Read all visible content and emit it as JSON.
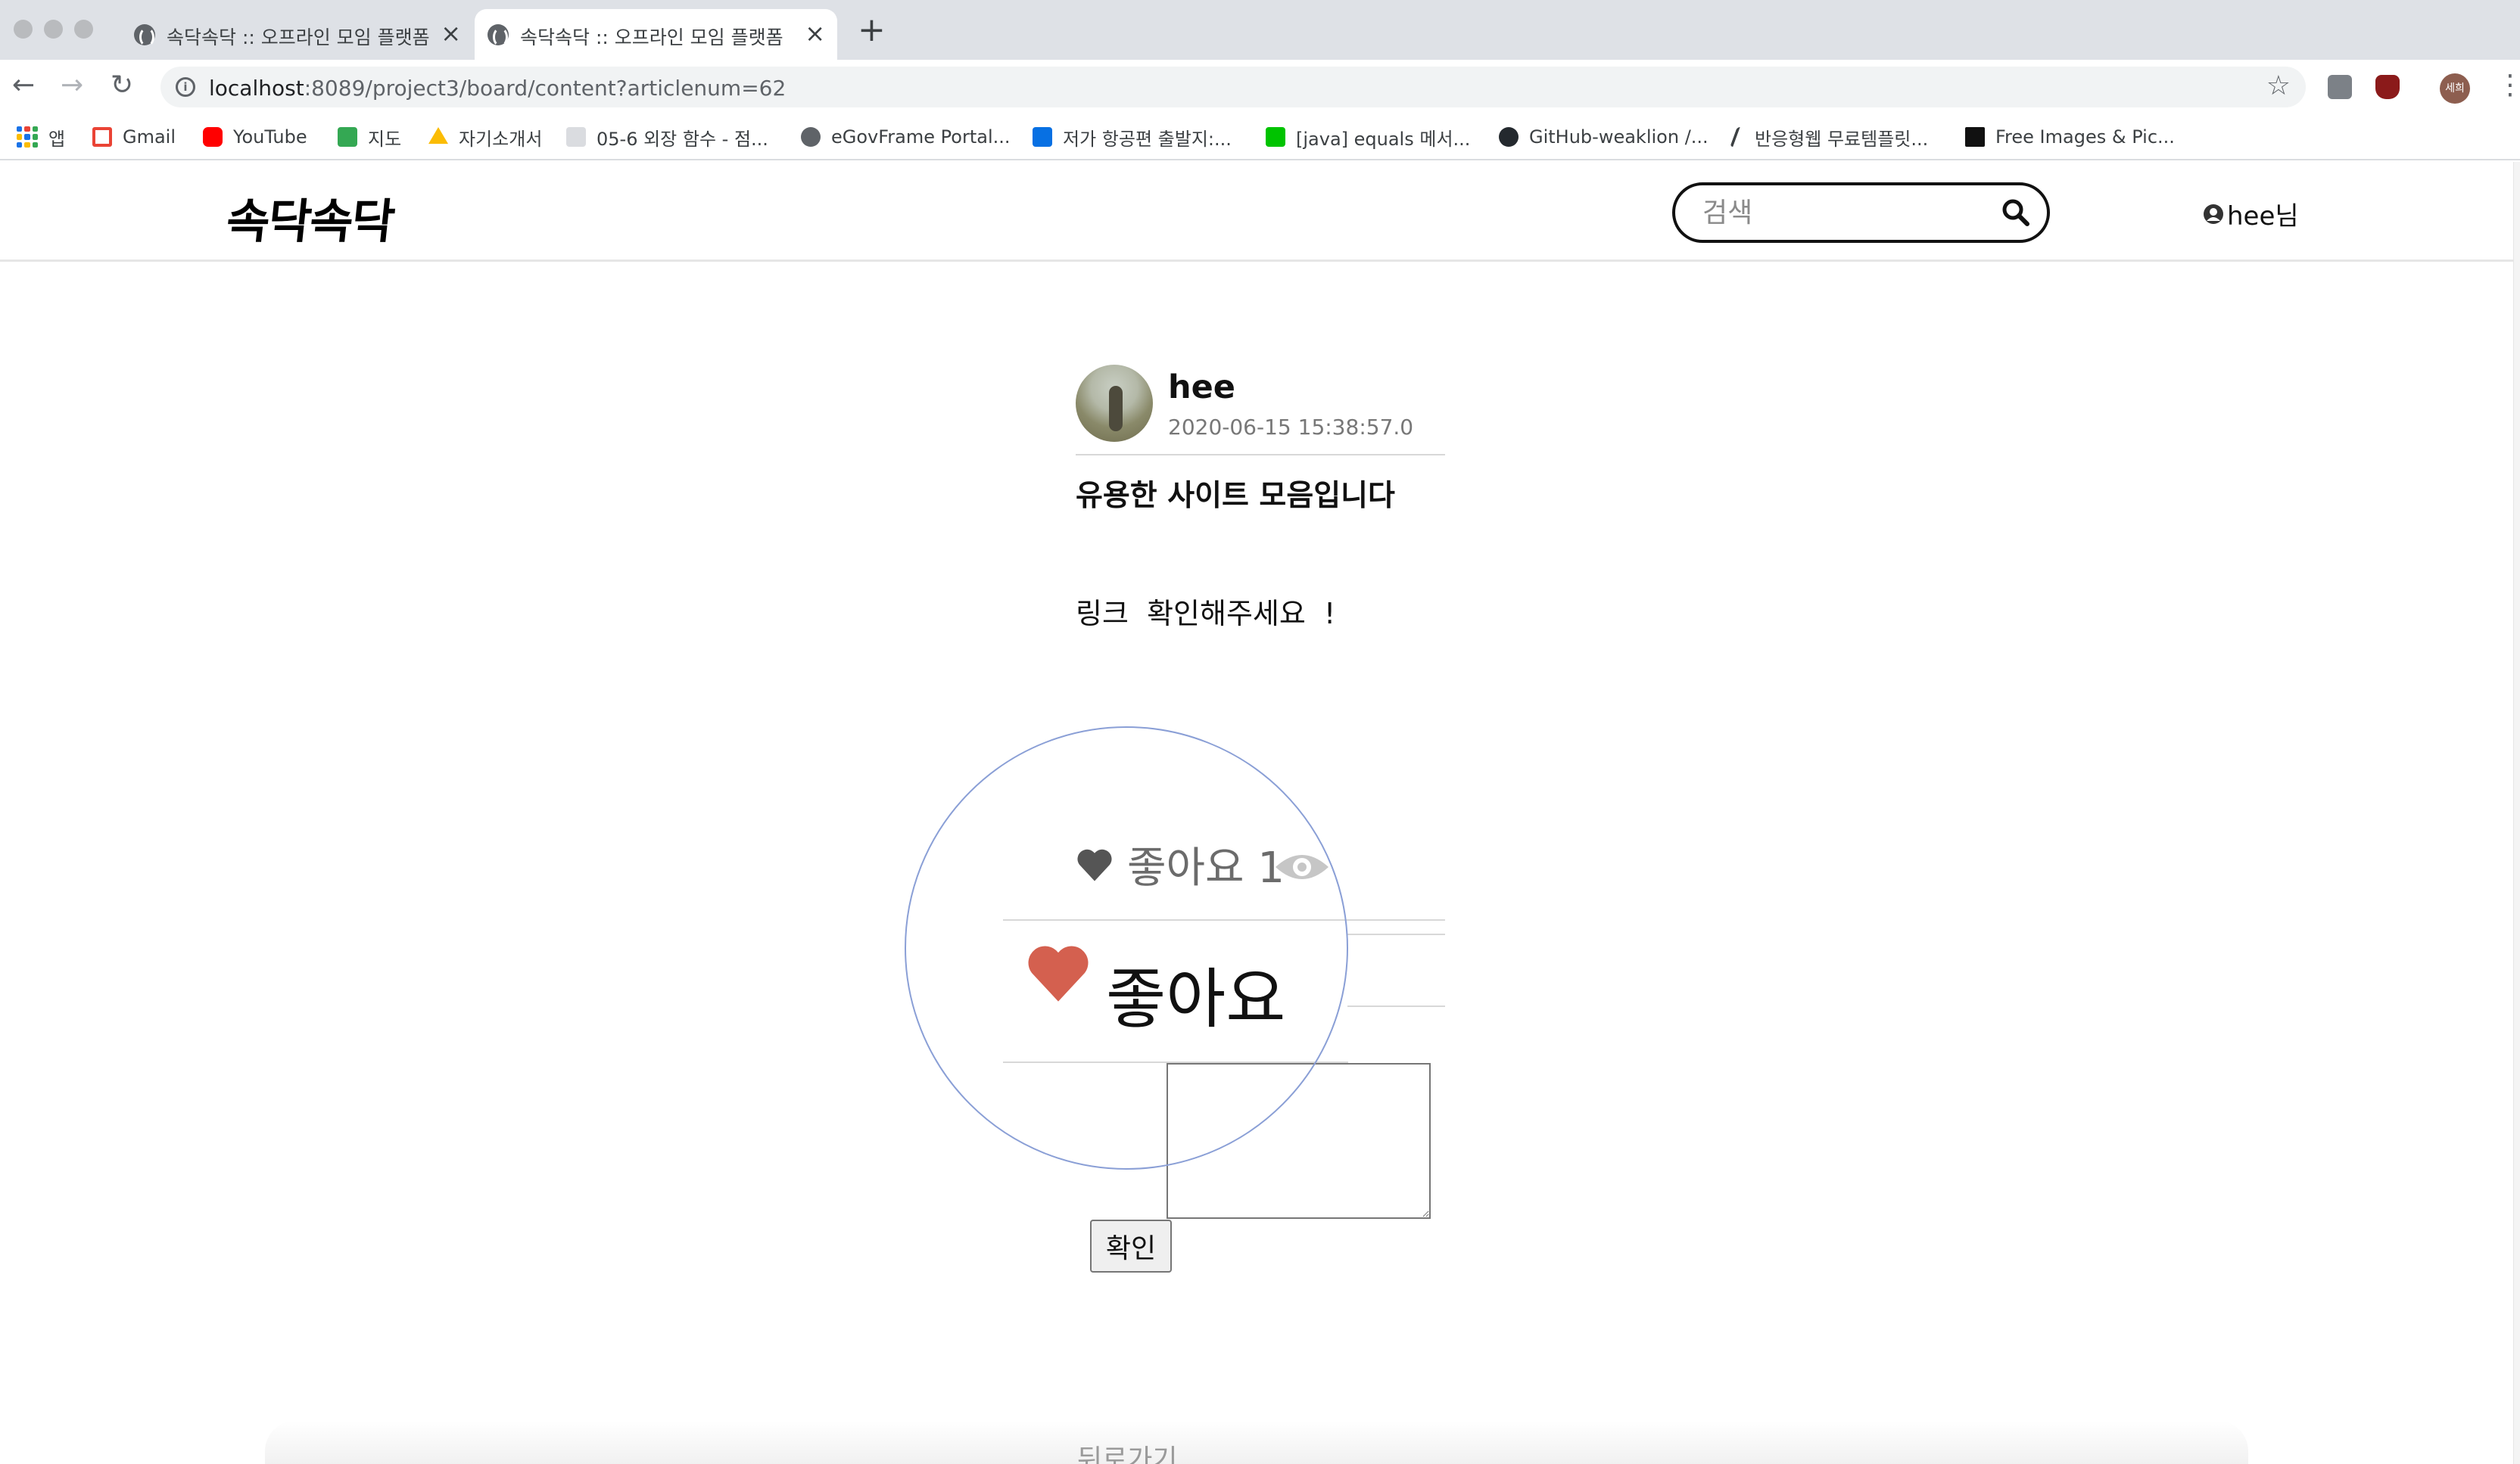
{
  "browser": {
    "tabs": [
      {
        "title": "속닥속닥 :: 오프라인 모임 플랫폼",
        "active": false
      },
      {
        "title": "속닥속닥 :: 오프라인 모임 플랫폼",
        "active": true
      }
    ],
    "address": {
      "host": "localhost",
      "path": ":8089/project3/board/content?articlenum=62"
    },
    "profile_initials": "세희",
    "bookmarks": [
      {
        "label": "앱",
        "icon": "apps-grid-icon"
      },
      {
        "label": "Gmail",
        "icon": "gmail-icon",
        "color": "#ea4335"
      },
      {
        "label": "YouTube",
        "icon": "youtube-icon",
        "color": "#ff0000"
      },
      {
        "label": "지도",
        "icon": "maps-icon",
        "color": "#34a853"
      },
      {
        "label": "자기소개서",
        "icon": "drive-icon",
        "color": "#fbbc04"
      },
      {
        "label": "05-6 외장 함수 - 점...",
        "icon": "wikidocs-icon",
        "color": "#9aa0a6"
      },
      {
        "label": "eGovFrame Portal...",
        "icon": "globe-icon",
        "color": "#5f6368"
      },
      {
        "label": "저가 항공편 출발지:...",
        "icon": "skyscanner-icon",
        "color": "#0770e3"
      },
      {
        "label": "[java] equals 메서...",
        "icon": "line-icon",
        "color": "#00c300"
      },
      {
        "label": "GitHub-weaklion /...",
        "icon": "github-icon",
        "color": "#24292e"
      },
      {
        "label": "반응형웹 무료템플릿...",
        "icon": "pen-icon",
        "color": "#3c4043"
      },
      {
        "label": "Free Images & Pic...",
        "icon": "unsplash-icon",
        "color": "#111111"
      }
    ]
  },
  "site": {
    "logo": "속닥속닥",
    "search_placeholder": "검색",
    "user_label": "hee님"
  },
  "post": {
    "author": "hee",
    "date": "2020-06-15 15:38:57.0",
    "title": "유용한 사이트 모음입니다",
    "body": "링크  확인해주세요  !",
    "like_count_label": "좋아요 1",
    "like_button_label": "좋아요",
    "confirm_label": "확인",
    "back_label": "뒤로가기"
  },
  "colors": {
    "heart": "#d4604f",
    "heart_gray": "#555555"
  }
}
